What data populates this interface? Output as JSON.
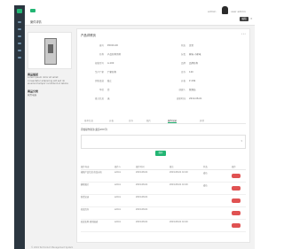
{
  "header": {
    "breadcrumb": "案件详情",
    "user_short": "admin",
    "user_name": "user admin",
    "action_button": "编辑"
  },
  "left_panel": {
    "section_title": "商品描述",
    "description": "Lorem ipsum dolor sit amet consectetur adipiscing elit sed do eiusmod tempor incididunt ut labore",
    "section2_title": "商品分类",
    "section2_value": "家用电器"
  },
  "main": {
    "title": "产品详情页",
    "fields": [
      {
        "k": "编号",
        "v": "P2019-00"
      },
      {
        "k": "名称",
        "v": "产品名称示例"
      },
      {
        "k": "规格型号",
        "v": "A-100"
      },
      {
        "k": "生产厂家",
        "v": "厂家名称"
      },
      {
        "k": "销售渠道",
        "v": "线上"
      },
      {
        "k": "单位",
        "v": "台"
      },
      {
        "k": "备注信息",
        "v": "无"
      },
      {
        "k": "状态",
        "v": "正常"
      },
      {
        "k": "分类",
        "v": "家电-小家电"
      },
      {
        "k": "品牌",
        "v": "品牌名称"
      },
      {
        "k": "库存",
        "v": "120"
      },
      {
        "k": "价格",
        "v": "¥ 299"
      },
      {
        "k": "创建人",
        "v": "管理员"
      },
      {
        "k": "更新时间",
        "v": "2019-08-01"
      }
    ],
    "tabs": [
      "基本信息",
      "价格",
      "库存",
      "图片",
      "操作记录",
      "其他"
    ],
    "active_tab_index": 4,
    "section_title": "添加操作备注(最多200字)",
    "input_placeholder": "",
    "save_button": "保存",
    "table_headers": [
      "操作内容",
      "操作人",
      "操作时间",
      "备注",
      "状态",
      "操作"
    ],
    "rows": [
      [
        "编辑产品信息 修改价格",
        "admin",
        "2019-08-01",
        "2019-08-01 10:20",
        "成功"
      ],
      [
        "删除图片",
        "admin",
        "2019-08-01",
        "2019-08-01 10:20",
        "成功"
      ],
      [
        "新增记录",
        "admin",
        "2019-08-01",
        "",
        ""
      ],
      [
        "修改库存",
        "admin",
        "2019-08-01",
        "",
        ""
      ],
      [
        "修改名称 更新描述",
        "admin",
        "2019-08-01",
        "2019-08-01 10:20",
        ""
      ]
    ]
  },
  "footer": "© 2019 Tel Product Management System"
}
